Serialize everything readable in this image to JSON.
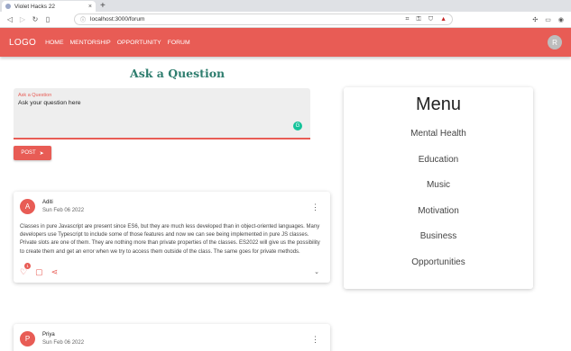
{
  "browser": {
    "tab_title": "Violet Hacks 22",
    "new_tab": "+",
    "url": "localhost:3000/forum"
  },
  "appbar": {
    "logo": "LOGO",
    "links": [
      "HOME",
      "MENTORSHIP",
      "OPPORTUNITY",
      "FORUM"
    ],
    "avatar": "R"
  },
  "ask": {
    "title": "Ask a Question",
    "field_label": "Ask a Question",
    "field_value": "Ask your question here",
    "post_label": "POST"
  },
  "posts": [
    {
      "avatar": "A",
      "author": "Aditi",
      "date": "Sun Feb 06 2022",
      "body": "Classes in pure Javascript are present since ES6, but they are much less developed than in object-oriented languages. Many developers use Typescript to include some of those features and now we can see being implemented in pure JS classes. Private slots are one of them. They are nothing more than private properties of the classes. ES2022 will give us the possibility to create them and get an error when we try to access them outside of the class. The same goes for private methods.",
      "likes": "1"
    },
    {
      "avatar": "P",
      "author": "Priya",
      "date": "Sun Feb 06 2022"
    }
  ],
  "menu": {
    "title": "Menu",
    "items": [
      "Mental Health",
      "Education",
      "Music",
      "Motivation",
      "Business",
      "Opportunities"
    ]
  },
  "colors": {
    "accent": "#e85c55",
    "title_green": "#2e7d6e"
  }
}
